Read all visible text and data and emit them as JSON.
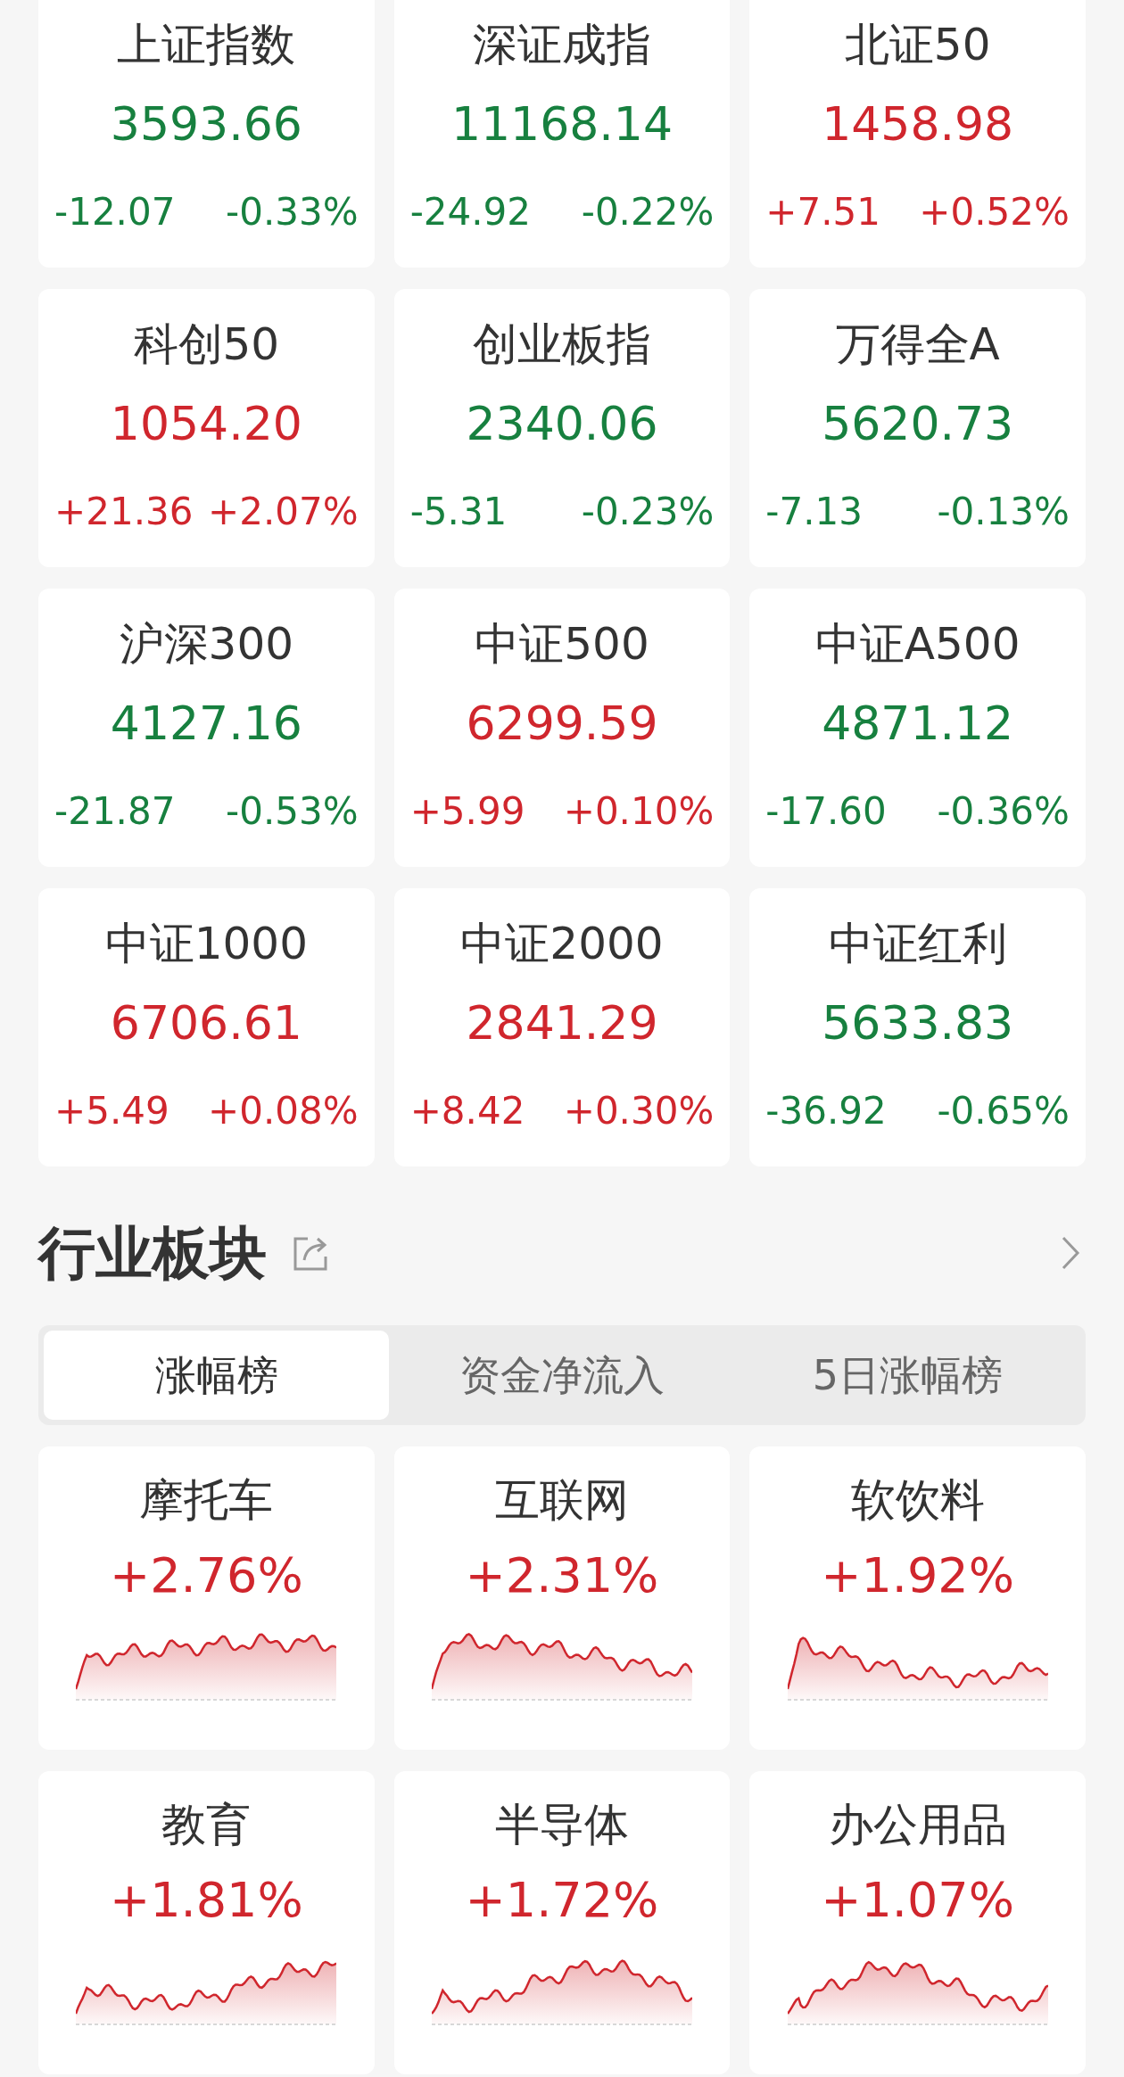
{
  "indices": [
    {
      "name": "上证指数",
      "value": "3593.66",
      "change": "-12.07",
      "pct": "-0.33%",
      "color": "#17803f"
    },
    {
      "name": "深证成指",
      "value": "11168.14",
      "change": "-24.92",
      "pct": "-0.22%",
      "color": "#17803f"
    },
    {
      "name": "北证50",
      "value": "1458.98",
      "change": "+7.51",
      "pct": "+0.52%",
      "color": "#d0262d"
    },
    {
      "name": "科创50",
      "value": "1054.20",
      "change": "+21.36",
      "pct": "+2.07%",
      "color": "#d0262d"
    },
    {
      "name": "创业板指",
      "value": "2340.06",
      "change": "-5.31",
      "pct": "-0.23%",
      "color": "#17803f"
    },
    {
      "name": "万得全A",
      "value": "5620.73",
      "change": "-7.13",
      "pct": "-0.13%",
      "color": "#17803f"
    },
    {
      "name": "沪深300",
      "value": "4127.16",
      "change": "-21.87",
      "pct": "-0.53%",
      "color": "#17803f"
    },
    {
      "name": "中证500",
      "value": "6299.59",
      "change": "+5.99",
      "pct": "+0.10%",
      "color": "#d0262d"
    },
    {
      "name": "中证A500",
      "value": "4871.12",
      "change": "-17.60",
      "pct": "-0.36%",
      "color": "#17803f"
    },
    {
      "name": "中证1000",
      "value": "6706.61",
      "change": "+5.49",
      "pct": "+0.08%",
      "color": "#d0262d"
    },
    {
      "name": "中证2000",
      "value": "2841.29",
      "change": "+8.42",
      "pct": "+0.30%",
      "color": "#d0262d"
    },
    {
      "name": "中证红利",
      "value": "5633.83",
      "change": "-36.92",
      "pct": "-0.65%",
      "color": "#17803f"
    }
  ],
  "section": {
    "title": "行业板块"
  },
  "tabs": [
    {
      "label": "涨幅榜",
      "selected": true
    },
    {
      "label": "资金净流入",
      "selected": false
    },
    {
      "label": "5日涨幅榜",
      "selected": false
    }
  ],
  "sectors": [
    {
      "name": "摩托车",
      "pct": "+2.76%",
      "color": "#d0262d"
    },
    {
      "name": "互联网",
      "pct": "+2.31%",
      "color": "#d0262d"
    },
    {
      "name": "软饮料",
      "pct": "+1.92%",
      "color": "#d0262d"
    },
    {
      "name": "教育",
      "pct": "+1.81%",
      "color": "#d0262d"
    },
    {
      "name": "半导体",
      "pct": "+1.72%",
      "color": "#d0262d"
    },
    {
      "name": "办公用品",
      "pct": "+1.07%",
      "color": "#d0262d"
    }
  ]
}
